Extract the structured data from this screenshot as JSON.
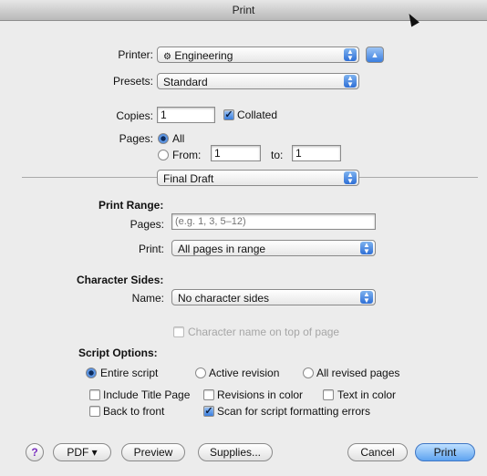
{
  "window": {
    "title": "Print"
  },
  "printer": {
    "label": "Printer:",
    "value": "Engineering",
    "status_glyph": "⚙"
  },
  "presets": {
    "label": "Presets:",
    "value": "Standard"
  },
  "copies": {
    "label": "Copies:",
    "value": "1",
    "collated_label": "Collated",
    "collated": true
  },
  "pages": {
    "label": "Pages:",
    "all_label": "All",
    "from_label": "From:",
    "from_value": "1",
    "to_label": "to:",
    "to_value": "1"
  },
  "panel": {
    "value": "Final Draft"
  },
  "print_range": {
    "heading": "Print Range:",
    "pages_label": "Pages:",
    "pages_placeholder": "(e.g. 1, 3, 5–12)",
    "print_label": "Print:",
    "print_value": "All pages in range"
  },
  "character_sides": {
    "heading": "Character Sides:",
    "name_label": "Name:",
    "name_value": "No character sides",
    "on_top_label": "Character name on top of page"
  },
  "script_options": {
    "heading": "Script Options:",
    "entire_label": "Entire script",
    "active_label": "Active revision",
    "all_revised_label": "All revised pages",
    "include_title_label": "Include Title Page",
    "revisions_color_label": "Revisions in color",
    "text_color_label": "Text in color",
    "back_to_front_label": "Back to front",
    "scan_label": "Scan for script formatting errors"
  },
  "buttons": {
    "help": "?",
    "pdf": "PDF ▾",
    "preview": "Preview",
    "supplies": "Supplies...",
    "cancel": "Cancel",
    "print": "Print"
  }
}
